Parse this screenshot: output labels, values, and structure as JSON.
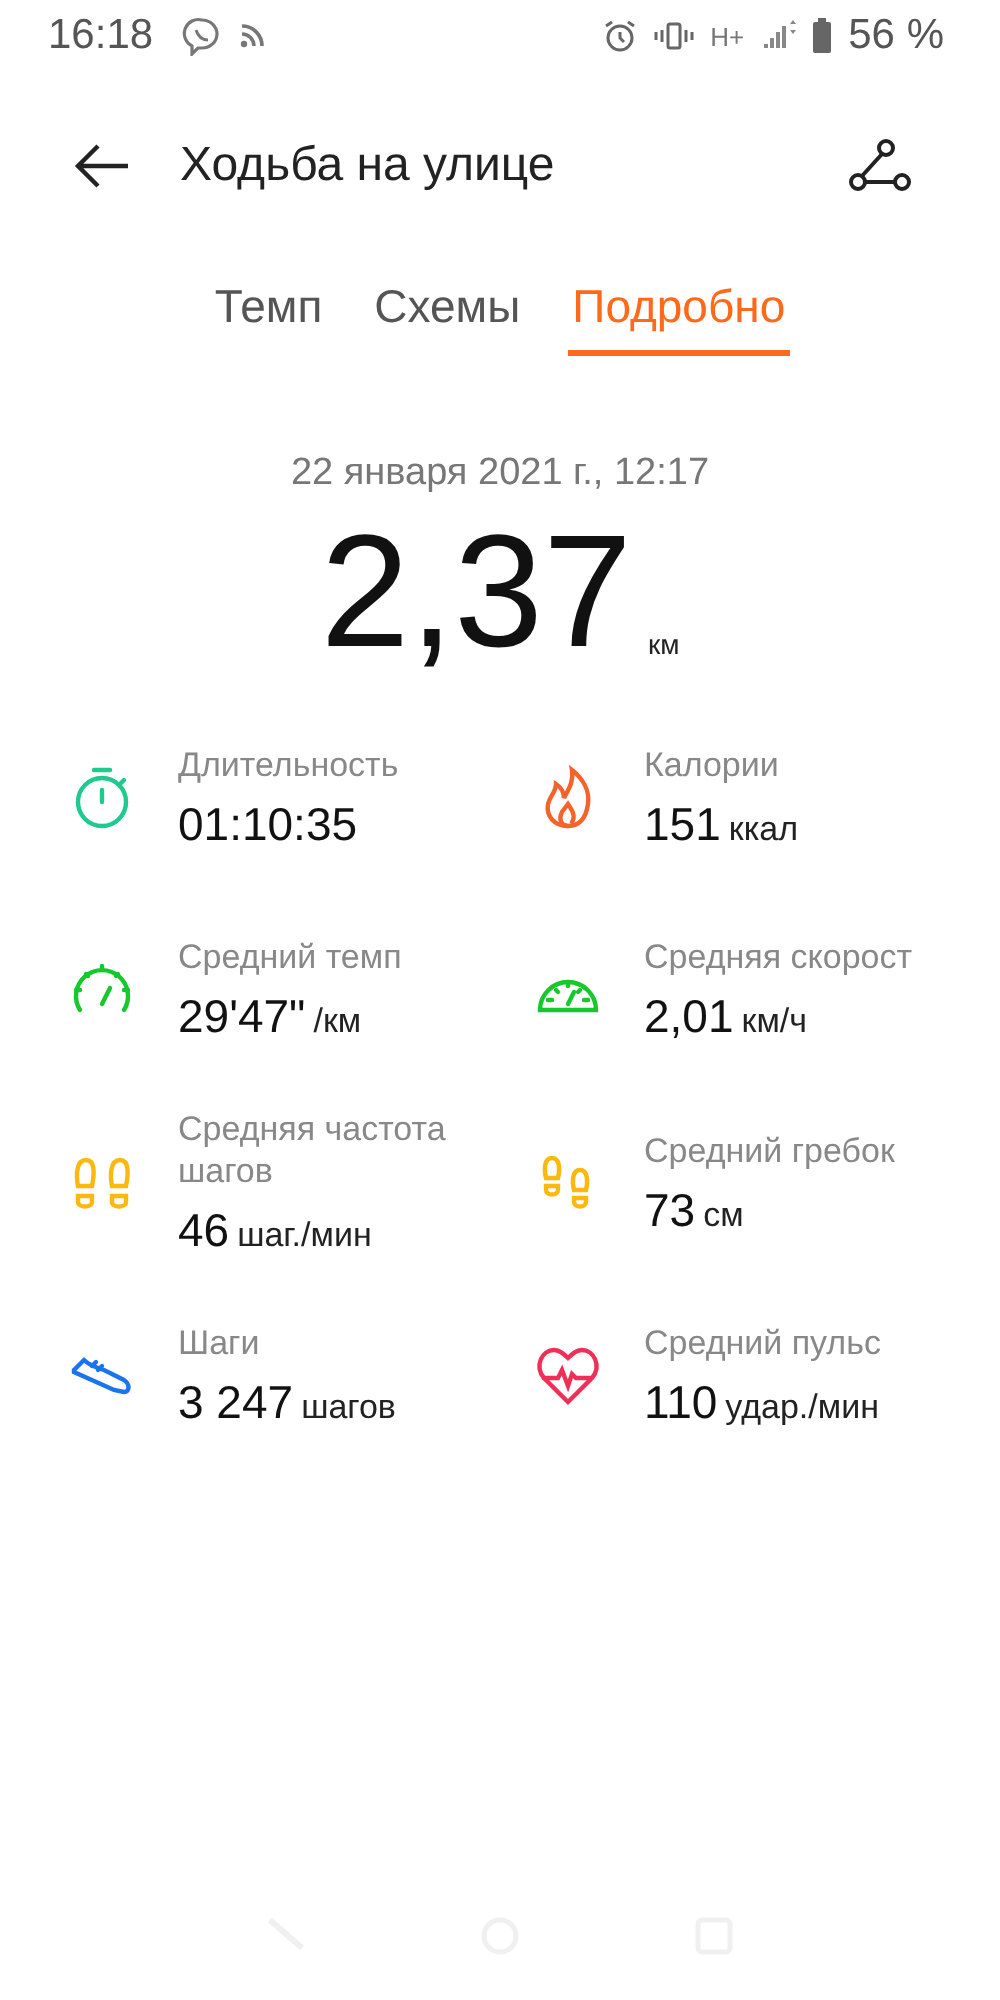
{
  "status_bar": {
    "time": "16:18",
    "network": "H+",
    "battery": "56 %"
  },
  "header": {
    "title": "Ходьба на улице"
  },
  "tabs": [
    {
      "label": "Темп",
      "selected": false
    },
    {
      "label": "Схемы",
      "selected": false
    },
    {
      "label": "Подробно",
      "selected": true
    }
  ],
  "summary": {
    "date": "22 января 2021 г., 12:17",
    "distance": "2,37",
    "unit": "км"
  },
  "metrics": [
    {
      "kind": "stopwatch",
      "color": "#1ecb8c",
      "label": "Длительность",
      "value": "01:10:35"
    },
    {
      "kind": "flame",
      "color": "#f5622a",
      "label": "Калории",
      "value": "151",
      "unit": "ккал"
    },
    {
      "kind": "gauge",
      "color": "#17c82c",
      "label": "Средний темп",
      "value": "29'47\"",
      "unit": "/км"
    },
    {
      "kind": "speedometer",
      "color": "#17c82c",
      "label": "Средняя скорост",
      "value": "2,01",
      "unit": "км/ч"
    },
    {
      "kind": "footprints",
      "color": "#fbb80f",
      "label": "Средняя частота шагов",
      "value": "46",
      "unit": "шаг./мин"
    },
    {
      "kind": "footprints_offset",
      "color": "#fbb80f",
      "label": "Средний гребок",
      "value": "73",
      "unit": "см"
    },
    {
      "kind": "shoe",
      "color": "#1a74f0",
      "label": "Шаги",
      "value": "3 247",
      "unit": "шагов"
    },
    {
      "kind": "heart",
      "color": "#ee3058",
      "label": "Средний пульс",
      "value": "110",
      "unit": "удар./мин"
    }
  ]
}
